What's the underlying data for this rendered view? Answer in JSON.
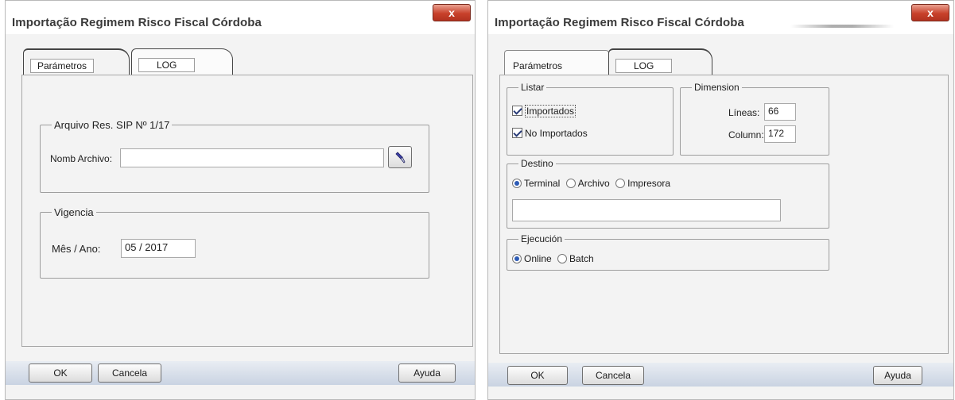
{
  "left_window": {
    "title": "Importação Regimem Risco Fiscal Córdoba",
    "close_label": "x",
    "tabs": [
      {
        "label": "Parámetros"
      },
      {
        "label": "LOG"
      }
    ],
    "groups": {
      "file": {
        "legend": "Arquivo Res. SIP Nº 1/17",
        "field_label": "Nomb Archivo:",
        "field_value": ""
      },
      "period": {
        "legend": "Vigencia",
        "field_label": "Mês / Ano:",
        "field_value": "05 / 2017"
      }
    },
    "buttons": {
      "ok": "OK",
      "cancel": "Cancela",
      "help": "Ayuda"
    }
  },
  "right_window": {
    "title": "Importação Regimem Risco Fiscal Córdoba",
    "close_label": "x",
    "tabs": [
      {
        "label": "Parámetros"
      },
      {
        "label": "LOG"
      }
    ],
    "listar": {
      "legend": "Listar",
      "options": [
        {
          "label": "Importados",
          "checked": true
        },
        {
          "label": "No Importados",
          "checked": true
        }
      ]
    },
    "dimension": {
      "legend": "Dimension",
      "lines_label": "Líneas:",
      "lines_value": "66",
      "columns_label": "Column:",
      "columns_value": "172"
    },
    "destino": {
      "legend": "Destino",
      "options": [
        {
          "label": "Terminal",
          "selected": true
        },
        {
          "label": "Archivo",
          "selected": false
        },
        {
          "label": "Impresora",
          "selected": false
        }
      ],
      "path_value": ""
    },
    "ejecucion": {
      "legend": "Ejecución",
      "options": [
        {
          "label": "Online",
          "selected": true
        },
        {
          "label": "Batch",
          "selected": false
        }
      ]
    },
    "buttons": {
      "ok": "OK",
      "cancel": "Cancela",
      "help": "Ayuda"
    }
  }
}
